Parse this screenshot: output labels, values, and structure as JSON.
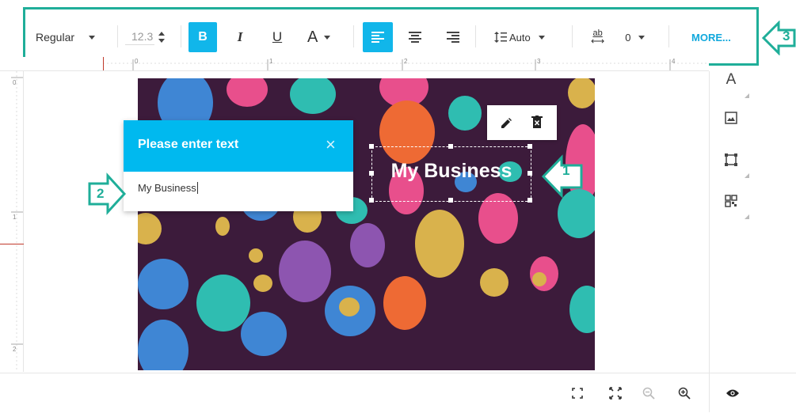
{
  "toolbar": {
    "font_style": "Regular",
    "font_size": "12.3",
    "bold_label": "B",
    "italic_label": "I",
    "underline_label": "U",
    "font_color_label": "A",
    "line_height_label": "Auto",
    "spacing_icon_label": "ab",
    "letter_spacing_value": "0",
    "more_label": "MORE..."
  },
  "ruler": {
    "top_ticks": [
      "0",
      "1",
      "2",
      "3",
      "4"
    ],
    "left_ticks": [
      "0",
      "1",
      "2"
    ]
  },
  "canvas": {
    "selected_text": "My Business"
  },
  "text_dialog": {
    "title": "Please enter text",
    "close_label": "×",
    "input_value": "My Business"
  },
  "side_panel": {
    "text_tool_label": "A",
    "tools": [
      "text-tool",
      "image-tool",
      "shape-tool",
      "qr-code-tool"
    ]
  },
  "bottom_bar": {
    "tools": [
      "fit-page",
      "fullscreen",
      "zoom-out",
      "zoom-in",
      "preview"
    ]
  },
  "callouts": {
    "one": "1",
    "two": "2",
    "three": "3"
  },
  "colors": {
    "accent": "#00b9ef",
    "annotation": "#1fae99",
    "artboard_bg": "#3c1b3b"
  }
}
